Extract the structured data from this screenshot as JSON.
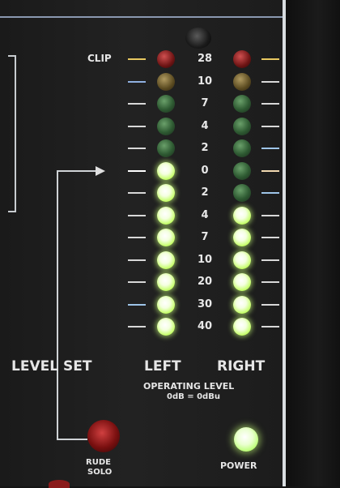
{
  "meter": {
    "clip_label": "CLIP",
    "scale": [
      "28",
      "10",
      "7",
      "4",
      "2",
      "0",
      "2",
      "4",
      "7",
      "10",
      "20",
      "30",
      "40"
    ],
    "left_states": [
      "red",
      "amber",
      "green",
      "green",
      "green",
      "on",
      "on",
      "on",
      "on",
      "on",
      "on",
      "on",
      "on"
    ],
    "right_states": [
      "red",
      "amber",
      "green",
      "green",
      "green",
      "green",
      "green",
      "on",
      "on",
      "on",
      "on",
      "on",
      "on"
    ],
    "tick_colors_left": [
      "#e8c860",
      "#8fb0e0",
      "#d8d8d8",
      "#d8d8d8",
      "#d8d8d8",
      "#ffffff",
      "#d8d8d8",
      "#d8d8d8",
      "#d8d8d8",
      "#d8d8d8",
      "#d8d8d8",
      "#9ec4e8",
      "#d8d8d8"
    ],
    "tick_colors_right": [
      "#e8c860",
      "#d8d8d8",
      "#d8d8d8",
      "#d8d8d8",
      "#9ec4e8",
      "#f0d8b0",
      "#9ec4e8",
      "#d8d8d8",
      "#d8d8d8",
      "#d8d8d8",
      "#d8d8d8",
      "#d8d8d8",
      "#d8d8d8"
    ]
  },
  "labels": {
    "level_set": "LEVEL SET",
    "left": "LEFT",
    "right": "RIGHT",
    "operating_level": "OPERATING LEVEL",
    "operating_ref": "0dB = 0dBu",
    "rude_line1": "RUDE",
    "rude_line2": "SOLO",
    "power": "POWER"
  }
}
